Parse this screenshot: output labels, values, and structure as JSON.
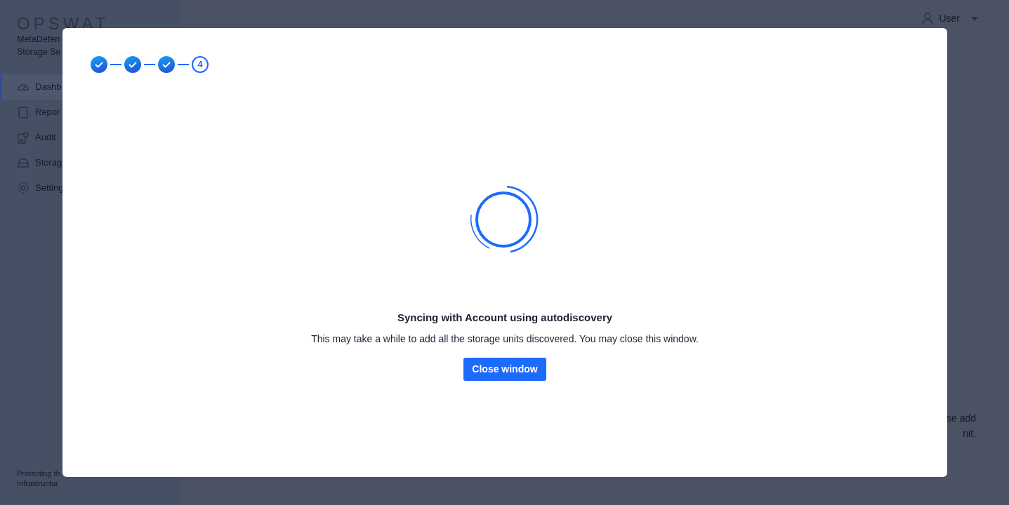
{
  "sidebar": {
    "brand": "OPSWAT",
    "product": [
      "MetaDefen",
      "Storage Se"
    ],
    "items": [
      {
        "label": "Dashb",
        "selected": true
      },
      {
        "label": "Repor",
        "selected": false
      },
      {
        "label": "Audit",
        "selected": false
      },
      {
        "label": "Storag",
        "selected": false
      },
      {
        "label": "Setting",
        "selected": false
      }
    ],
    "footer": [
      "Protecting th",
      "Infrastructur"
    ]
  },
  "header": {
    "user": "User"
  },
  "background_text": [
    "se add",
    "nit."
  ],
  "modal": {
    "steps": [
      {
        "kind": "done"
      },
      {
        "kind": "done"
      },
      {
        "kind": "done"
      },
      {
        "kind": "current",
        "number": "4"
      }
    ],
    "title": "Syncing with Account using autodiscovery",
    "message": "This may take a while to add all the storage units discovered. You may close this window.",
    "button": "Close window"
  }
}
